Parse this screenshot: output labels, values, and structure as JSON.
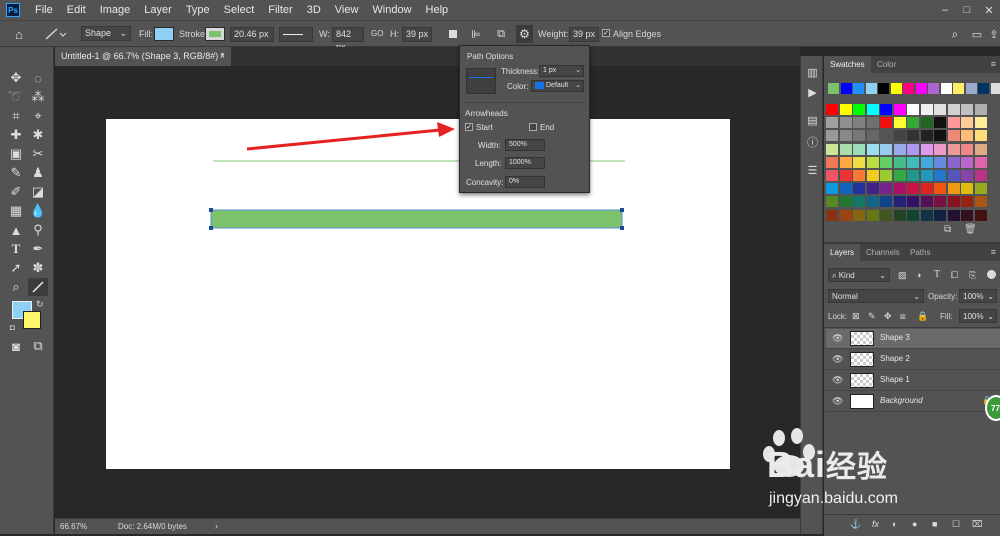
{
  "app": {
    "logo": "Ps"
  },
  "menu": [
    "File",
    "Edit",
    "Image",
    "Layer",
    "Type",
    "Select",
    "Filter",
    "3D",
    "View",
    "Window",
    "Help"
  ],
  "window_controls": [
    "–",
    "□",
    "✕"
  ],
  "options": {
    "tool_mode": "Shape",
    "fill_label": "Fill:",
    "fill_color": "#8fd1f5",
    "stroke_label": "Stroke:",
    "stroke_color": "#7cc16b",
    "stroke_width": "20.46 px",
    "w_label": "W:",
    "w_value": "842 px",
    "link_icon": "GO",
    "h_label": "H:",
    "h_value": "39 px",
    "weight_label": "Weight:",
    "weight_value": "39 px",
    "align_edges_label": "Align Edges",
    "align_edges_checked": true
  },
  "document": {
    "tab_title": "Untitled-1 @ 66.7% (Shape 3, RGB/8#) *",
    "tab_close": "×",
    "zoom": "66.67%",
    "doc_info": "Doc: 2.64M/0 bytes",
    "status_arrow": "›"
  },
  "path_options": {
    "title": "Path Options",
    "thickness_label": "Thickness:",
    "thickness_value": "1 px",
    "color_label": "Color:",
    "color_value": "Default",
    "color_swatch": "#1473e6",
    "arrowheads_label": "Arrowheads",
    "start_label": "Start",
    "start_checked": true,
    "end_label": "End",
    "end_checked": false,
    "width_label": "Width:",
    "width_value": "500%",
    "length_label": "Length:",
    "length_value": "1000%",
    "concavity_label": "Concavity:",
    "concavity_value": "0%"
  },
  "swatches_panel": {
    "tabs": [
      "Swatches",
      "Color"
    ],
    "recent": [
      "#7cc16b",
      "#0000ff",
      "#1e90ff",
      "#8fd1f5",
      "#000000",
      "#ffff00",
      "#ff0080",
      "#ff00ff",
      "#aa66cc",
      "#ffffff",
      "#ffee66",
      "#99aacc",
      "#003366",
      "#dddddd"
    ],
    "rows": [
      [
        "#ff0000",
        "#ffff00",
        "#00ff00",
        "#00ffff",
        "#0000ff",
        "#ff00ff",
        "#ffffff",
        "#f0f0f0",
        "#e0e0e0",
        "#d0d0d0",
        "#c0c0c0",
        "#b0b0b0"
      ],
      [
        "#a0a0a0",
        "#909090",
        "#808080",
        "#707070",
        "#ee1111",
        "#ffff33",
        "#33aa33",
        "#226622",
        "#111111",
        "#ff9999",
        "#ffcc99",
        "#ffee99"
      ],
      [
        "#999999",
        "#888888",
        "#777777",
        "#666666",
        "#555555",
        "#444444",
        "#333333",
        "#222222",
        "#111111",
        "#ee8877",
        "#ffbb77",
        "#ffdd77"
      ],
      [
        "#cce699",
        "#aaddaa",
        "#99ddbb",
        "#99ddee",
        "#99ccee",
        "#99aaee",
        "#aa99ee",
        "#dd99ee",
        "#ee99cc",
        "#ee9999",
        "#ee8888",
        "#ddaa88"
      ],
      [
        "#ee7755",
        "#ffaa44",
        "#eedd44",
        "#bbdd44",
        "#66cc66",
        "#44bb88",
        "#44bbbb",
        "#44aadd",
        "#6688dd",
        "#8866cc",
        "#bb66cc",
        "#dd66aa"
      ],
      [
        "#ee5566",
        "#ee3333",
        "#ff7733",
        "#eecc22",
        "#99cc33",
        "#33aa44",
        "#229988",
        "#2299bb",
        "#2277cc",
        "#5555bb",
        "#8844aa",
        "#bb3388"
      ],
      [
        "#1199dd",
        "#1166bb",
        "#223399",
        "#442288",
        "#772288",
        "#aa1166",
        "#cc1144",
        "#dd2222",
        "#ee5511",
        "#ee9911",
        "#ddbb11",
        "#99aa22"
      ],
      [
        "#558822",
        "#227733",
        "#117766",
        "#116688",
        "#114488",
        "#222277",
        "#331166",
        "#551155",
        "#771144",
        "#881122",
        "#992211",
        "#aa5511"
      ],
      [
        "#883311",
        "#994411",
        "#886611",
        "#667711",
        "#445522",
        "#224422",
        "#114433",
        "#113344",
        "#112244",
        "#221133",
        "#331122",
        "#441111"
      ]
    ]
  },
  "layers_panel": {
    "tabs": [
      "Layers",
      "Channels",
      "Paths"
    ],
    "kind_label": "Kind",
    "blend_mode": "Normal",
    "opacity_label": "Opacity:",
    "opacity_value": "100%",
    "lock_label": "Lock:",
    "fill_label": "Fill:",
    "fill_value": "100%",
    "layers": [
      {
        "name": "Shape 3",
        "selected": true,
        "shape": true
      },
      {
        "name": "Shape 2",
        "selected": false,
        "shape": true
      },
      {
        "name": "Shape 1",
        "selected": false,
        "shape": true
      },
      {
        "name": "Background",
        "selected": false,
        "shape": false
      }
    ],
    "bottom_icons": [
      "⚓",
      "fx",
      "◐",
      "●",
      "■",
      "☐",
      "⌧"
    ]
  },
  "canvas": {
    "bar_fill": "#7cc16b",
    "line_color": "#9bd28c",
    "arrow_color": "#e52222"
  },
  "watermark": {
    "brand": "Bai",
    "brand2": "经验",
    "url": "jingyan.baidu.com",
    "badge": "77"
  }
}
